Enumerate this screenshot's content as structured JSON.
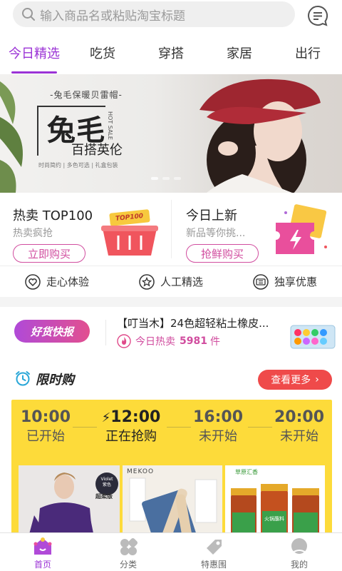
{
  "search": {
    "placeholder": "输入商品名或粘贴淘宝标题",
    "icon": "search-icon"
  },
  "header": {
    "message_icon": "message-icon"
  },
  "tabs": [
    {
      "label": "今日精选",
      "active": true
    },
    {
      "label": "吃货"
    },
    {
      "label": "穿搭"
    },
    {
      "label": "家居"
    },
    {
      "label": "出行"
    }
  ],
  "banner": {
    "subtitle": "-兔毛保暖贝雷帽-",
    "title": "兔毛",
    "hot_sale": "HOT SALE",
    "tagline": "百搭英伦",
    "features": "时尚简约 | 多色可选 | 礼盒包装"
  },
  "promo": [
    {
      "title": "热卖 TOP100",
      "subtitle": "热卖疯抢",
      "button": "立即购买",
      "image_text": "TOP100"
    },
    {
      "title": "今日上新",
      "subtitle": "新品等你挑...",
      "button": "抢鲜购买"
    }
  ],
  "features": [
    {
      "label": "走心体验",
      "icon": "heart-icon"
    },
    {
      "label": "人工精选",
      "icon": "star-icon"
    },
    {
      "label": "独享优惠",
      "icon": "coupon-icon"
    }
  ],
  "news": {
    "badge": "好货快报",
    "title": "【叮当木】24色超轻粘土橡皮...",
    "hot_label": "今日热卖",
    "hot_count": "5981",
    "unit": "件"
  },
  "flash": {
    "title": "限时购",
    "more": "查看更多",
    "slots": [
      {
        "time": "10:00",
        "status": "已开始"
      },
      {
        "time": "12:00",
        "status": "正在抢购",
        "current": true
      },
      {
        "time": "16:00",
        "status": "未开始"
      },
      {
        "time": "20:00",
        "status": "未开始"
      }
    ],
    "products": [
      {
        "badge_line1": "Violet",
        "badge_line2": "紫色",
        "badge_line3": "超柔版"
      },
      {
        "brand": "MEKOO"
      },
      {
        "brand": "草原汇香",
        "label": "火锅蘸料"
      }
    ]
  },
  "nav": [
    {
      "label": "首页",
      "active": true
    },
    {
      "label": "分类"
    },
    {
      "label": "特惠围"
    },
    {
      "label": "我的"
    }
  ],
  "colors": {
    "accent": "#9b33d6",
    "pink": "#d14d9f",
    "red": "#ef4a4a",
    "yellow": "#fddb3a"
  }
}
